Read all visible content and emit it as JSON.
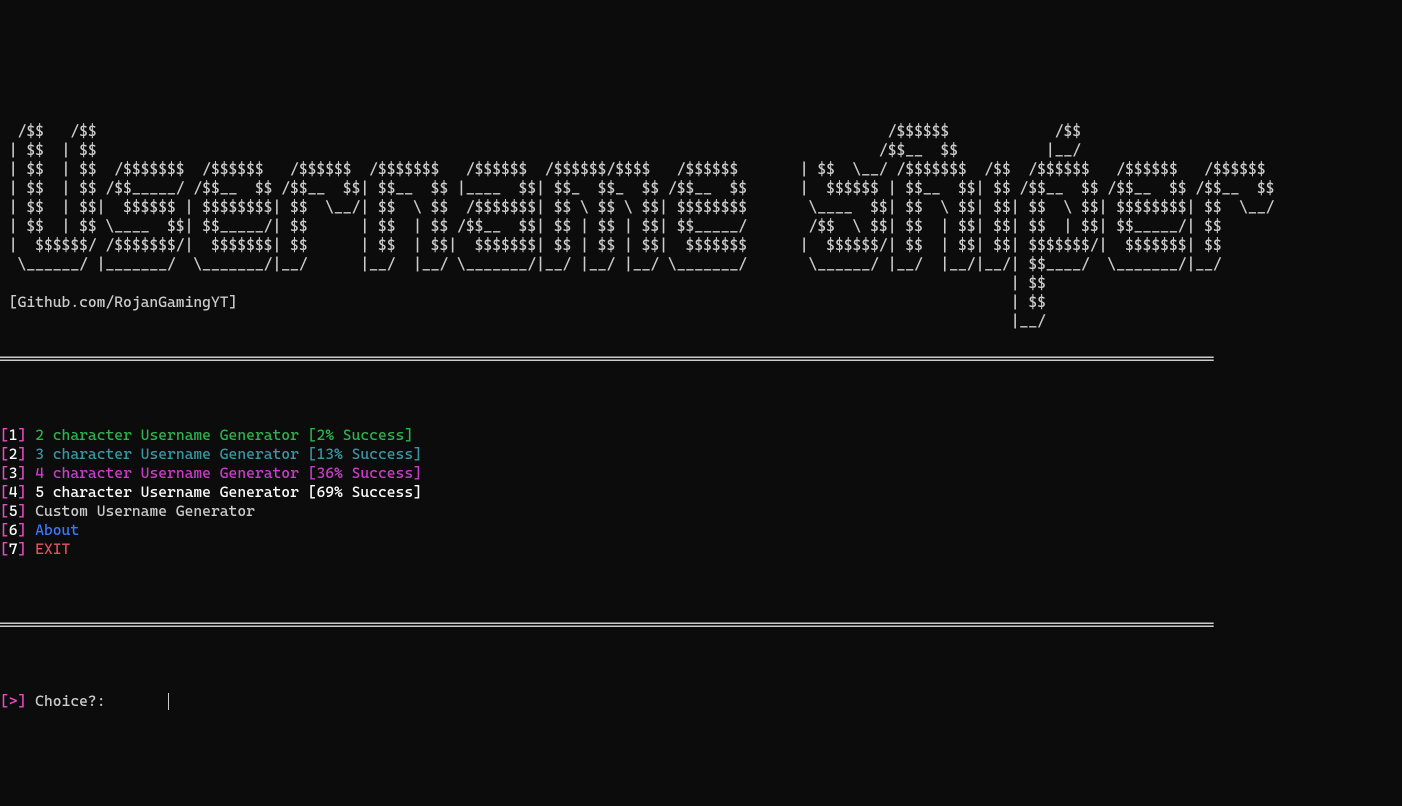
{
  "ascii_banner": [
    "",
    "",
    "  /$$   /$$                                                                                          /$$$$$$            /$$                              ",
    " | $$  | $$                                                                                         /$$__  $$          |__/                              ",
    " | $$  | $$  /$$$$$$$  /$$$$$$   /$$$$$$  /$$$$$$$   /$$$$$$  /$$$$$$/$$$$   /$$$$$$       | $$  \\__/ /$$$$$$$  /$$  /$$$$$$   /$$$$$$   /$$$$$$ ",
    " | $$  | $$ /$$_____/ /$$__  $$ /$$__  $$| $$__  $$ |____  $$| $$_  $$_  $$ /$$__  $$      |  $$$$$$ | $$__  $$| $$ /$$__  $$ /$$__  $$ /$$__  $$",
    " | $$  | $$|  $$$$$$ | $$$$$$$$| $$  \\__/| $$  \\ $$  /$$$$$$$| $$ \\ $$ \\ $$| $$$$$$$$       \\____  $$| $$  \\ $$| $$| $$  \\ $$| $$$$$$$$| $$  \\__/",
    " | $$  | $$ \\____  $$| $$_____/| $$      | $$  | $$ /$$__  $$| $$ | $$ | $$| $$_____/       /$$  \\ $$| $$  | $$| $$| $$  | $$| $$_____/| $$      ",
    " |  $$$$$$/ /$$$$$$$/|  $$$$$$$| $$      | $$  | $$|  $$$$$$$| $$ | $$ | $$|  $$$$$$$      |  $$$$$$/| $$  | $$| $$| $$$$$$$/|  $$$$$$$| $$      ",
    "  \\______/ |_______/  \\_______/|__/      |__/  |__/ \\_______/|__/ |__/ |__/ \\_______/       \\______/ |__/  |__/|__/| $$____/  \\_______/|__/      ",
    "                                                                                                                   | $$                          ",
    " [Github.com/RojanGamingYT]                                                                                        | $$                          ",
    "                                                                                                                   |__/                          "
  ],
  "separator": "══════════════════════════════════════════════════════════════════════════════════════════════════════════════════════════════════════════",
  "menu": {
    "items": [
      {
        "index": "1",
        "label": "2 character Username Generator [2% Success]",
        "color": "opt-green"
      },
      {
        "index": "2",
        "label": "3 character Username Generator [13% Success]",
        "color": "opt-teal"
      },
      {
        "index": "3",
        "label": "4 character Username Generator [36% Success]",
        "color": "opt-mag"
      },
      {
        "index": "4",
        "label": "5 character Username Generator [69% Success]",
        "color": "opt-white"
      },
      {
        "index": "5",
        "label": "Custom Username Generator",
        "color": "opt-gray"
      },
      {
        "index": "6",
        "label": "About",
        "color": "opt-blue"
      },
      {
        "index": "7",
        "label": "EXIT",
        "color": "opt-red"
      }
    ]
  },
  "prompt": {
    "symbol_open": "[",
    "symbol_gt": ">",
    "symbol_close": "]",
    "label": " Choice?: ",
    "value": ""
  }
}
